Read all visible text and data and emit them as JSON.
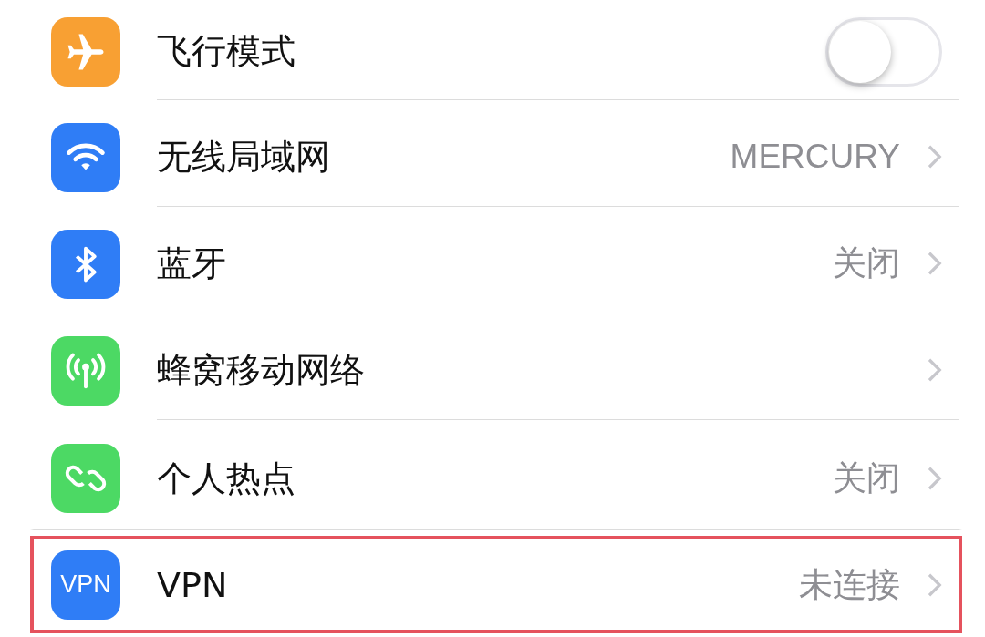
{
  "settings_rows": [
    {
      "kind": "toggle",
      "color": "#f8a033",
      "label": "飞行模式",
      "on": false,
      "highlighted": false
    },
    {
      "kind": "link",
      "color": "#2f7df6",
      "label": "无线局域网",
      "value": "MERCURY",
      "highlighted": false
    },
    {
      "kind": "link",
      "color": "#2f7df6",
      "label": "蓝牙",
      "value": "关闭",
      "highlighted": false
    },
    {
      "kind": "link",
      "color": "#4cd964",
      "label": "蜂窝移动网络",
      "highlighted": false
    },
    {
      "kind": "link",
      "color": "#4cd964",
      "label": "个人热点",
      "value": "关闭",
      "highlighted": false
    },
    {
      "kind": "link",
      "icon_text": "VPN",
      "color": "#2f7df6",
      "label": "VPN",
      "value": "未连接",
      "highlighted": true
    }
  ]
}
